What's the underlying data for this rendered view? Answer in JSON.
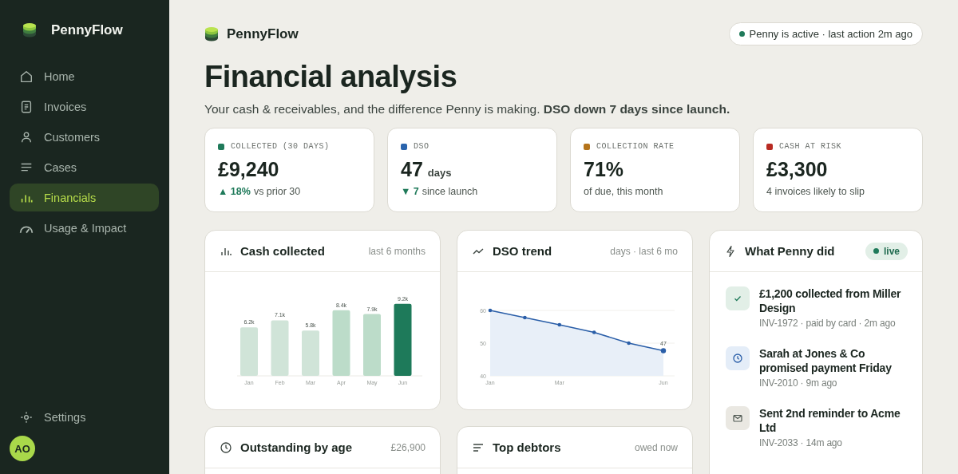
{
  "sidebar": {
    "brand": "PennyFlow",
    "items": [
      {
        "label": "Home",
        "selected": false
      },
      {
        "label": "Invoices",
        "selected": false
      },
      {
        "label": "Customers",
        "selected": false
      },
      {
        "label": "Cases",
        "selected": false
      },
      {
        "label": "Financials",
        "selected": true
      },
      {
        "label": "Usage & Impact",
        "selected": false
      }
    ],
    "settings": "Settings",
    "avatar": "AO"
  },
  "header": {
    "brand": "PennyFlow",
    "status": "Penny is active · last action 2m ago"
  },
  "title": "Financial analysis",
  "subtitle": "Your cash & receivables, and the difference Penny is making. **DSO down 7 days since launch.**",
  "kpis": [
    {
      "label": "COLLECTED (30 DAYS)",
      "color": "#1f7a5a",
      "value": "£9,240",
      "delta": "▲ 18%",
      "note": "vs prior 30"
    },
    {
      "label": "DSO",
      "color": "#2a64ad",
      "value": "47",
      "unit": "days",
      "delta": "▼ 7",
      "note": "since launch"
    },
    {
      "label": "COLLECTION RATE",
      "color": "#b5741b",
      "value": "71%",
      "note": "of due, this month"
    },
    {
      "label": "CASH AT RISK",
      "color": "#b82a22",
      "value": "£3,300",
      "note": "4 invoices likely to slip"
    }
  ],
  "cash_card": {
    "title": "Cash collected",
    "subtitle": "last 6 months",
    "chart_data": {
      "type": "bar",
      "categories": [
        "Jan",
        "Feb",
        "Mar",
        "Apr",
        "May",
        "Jun"
      ],
      "series": [
        {
          "color": "#d0e4d8",
          "values": [
            6.2,
            7.1,
            5.8,
            null,
            null,
            null
          ],
          "value_labels": [
            "6.2k",
            "7.1k",
            "5.8k",
            null,
            null,
            null
          ]
        },
        {
          "color": "#bcdcc9",
          "values": [
            null,
            null,
            null,
            8.4,
            7.9,
            null
          ],
          "value_labels": [
            null,
            null,
            null,
            "8.4k",
            "7.9k",
            null
          ]
        },
        {
          "color": "#1e7a5a",
          "values": [
            null,
            null,
            null,
            null,
            null,
            9.2
          ],
          "value_labels": [
            null,
            null,
            null,
            null,
            null,
            "9.2k"
          ]
        }
      ],
      "data_labels": true
    }
  },
  "dso_card": {
    "title": "DSO trend",
    "subtitle": "days · last 6 mo",
    "chart_data": {
      "type": "area",
      "categories": [
        "Jan",
        null,
        "Mar",
        null,
        null,
        "Jun"
      ],
      "series": [
        {
          "color": "#2a5ea8",
          "values": [
            60,
            57.8,
            55.6,
            53.3,
            50,
            47.7
          ]
        }
      ],
      "ylim": [
        40,
        60
      ],
      "yticks": [
        40,
        50,
        60
      ],
      "annotations": [
        {
          "x": "Jun",
          "y": 47.7,
          "text": "47"
        }
      ]
    }
  },
  "activity": {
    "title": "What Penny did",
    "badge": "live",
    "items": [
      {
        "kind": "payment",
        "title": "£1,200 collected from Miller Design",
        "meta": "INV-1972 · paid by card · 2m ago"
      },
      {
        "kind": "promise",
        "title": "Sarah at Jones & Co promised payment Friday",
        "meta": "INV-2010 · 9m ago"
      },
      {
        "kind": "reminder",
        "title": "Sent 2nd reminder to Acme Ltd",
        "meta": "INV-2033 · 14m ago"
      }
    ]
  },
  "outstanding_card": {
    "title": "Outstanding by age",
    "subtitle": "£26,900"
  },
  "debtors_card": {
    "title": "Top debtors",
    "subtitle": "owed now"
  }
}
